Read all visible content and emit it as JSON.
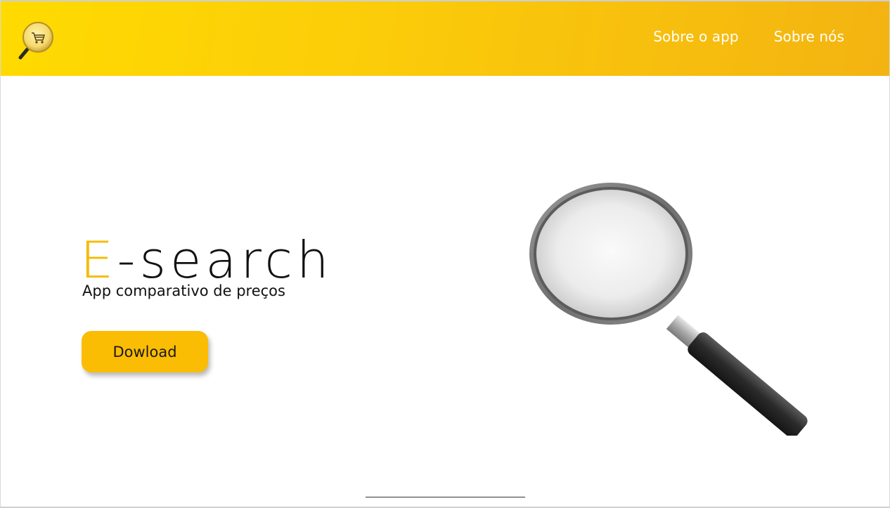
{
  "header": {
    "logo_icon": "magnifier-cart-icon",
    "nav": [
      {
        "label": "Sobre o app"
      },
      {
        "label": "Sobre nós"
      }
    ],
    "colors": {
      "gradient_start": "#ffdb00",
      "gradient_end": "#f3b311",
      "nav_text": "#ffffff"
    }
  },
  "hero": {
    "title_accent": "E",
    "title_rest": "-search",
    "subtitle": "App comparativo de preços",
    "download_label": "Dowload",
    "illustration_icon": "magnifying-glass-icon",
    "colors": {
      "accent": "#f4bb00",
      "button": "#fbbc04"
    }
  }
}
